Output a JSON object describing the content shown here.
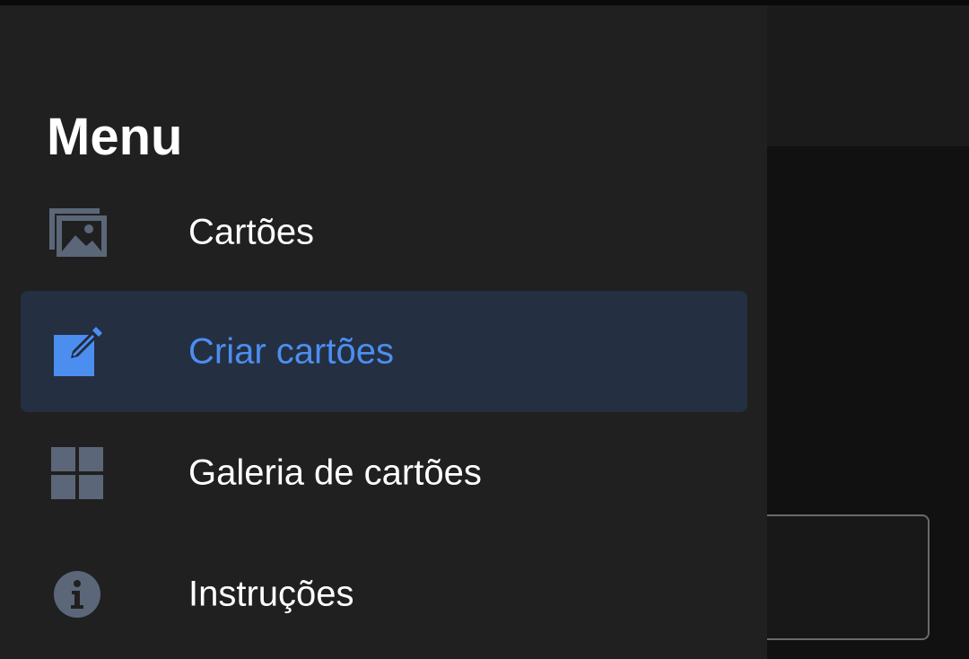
{
  "drawer": {
    "title": "Menu",
    "items": [
      {
        "label": "Cartões",
        "icon": "image-gallery-icon",
        "active": false
      },
      {
        "label": "Criar cartões",
        "icon": "edit-square-icon",
        "active": true
      },
      {
        "label": "Galeria de cartões",
        "icon": "grid-view-icon",
        "active": false
      },
      {
        "label": "Instruções",
        "icon": "info-icon",
        "active": false
      }
    ]
  },
  "colors": {
    "drawer_background": "#202020",
    "active_background": "#242f42",
    "accent": "#4c8ef0",
    "icon_gray": "#5b6778",
    "text": "#ffffff"
  }
}
